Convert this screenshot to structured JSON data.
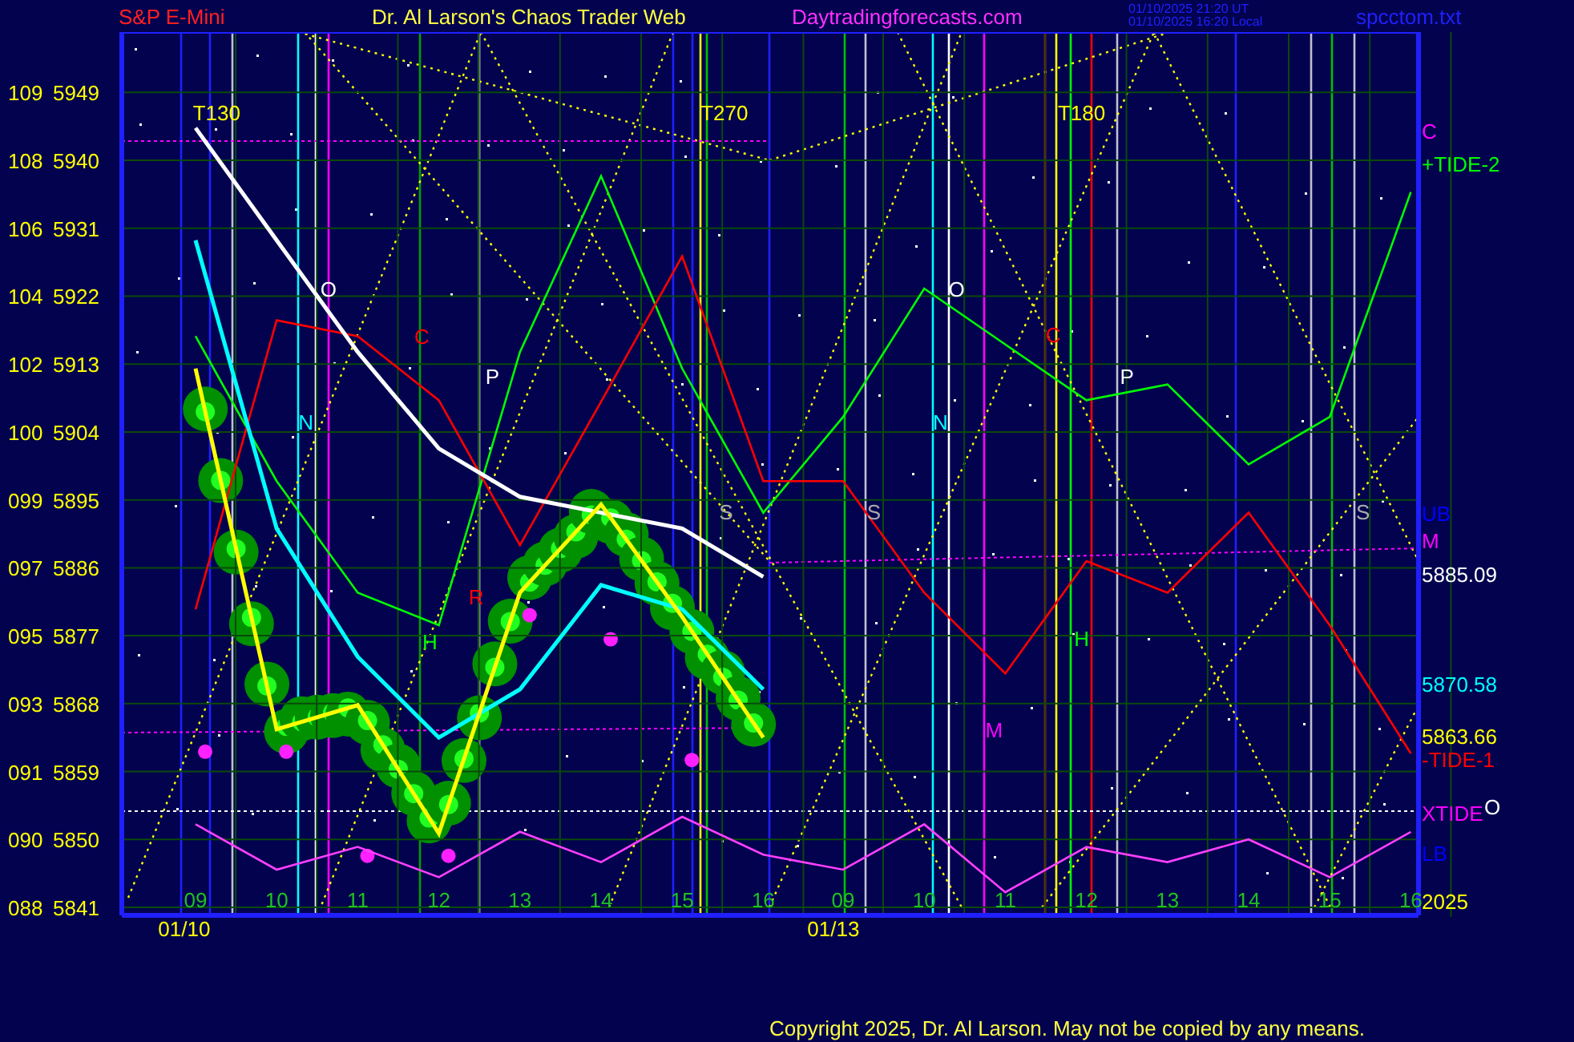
{
  "header": {
    "symbol": "S&P E-Mini",
    "title": "Dr. Al Larson's Chaos Trader Web",
    "site": "Daytradingforecasts.com",
    "time_ut": "01/10/2025 21:20 UT",
    "time_local": "01/10/2025 16:20 Local",
    "file": "spcctom.txt"
  },
  "chart": {
    "index_labels": [
      "109",
      "108",
      "106",
      "104",
      "102",
      "100",
      "099",
      "097",
      "095",
      "093",
      "091",
      "090",
      "088"
    ],
    "date_labels": [
      "01/10",
      "01/13"
    ],
    "right_labels": [
      {
        "text": "C",
        "color": "#ff00ff"
      },
      {
        "text": "+TIDE-2",
        "color": "#00ff00"
      },
      {
        "text": "UB",
        "color": "#0000ff"
      },
      {
        "text": "M",
        "color": "#ff00ff"
      },
      {
        "text": "5885.09",
        "color": "#ffffff"
      },
      {
        "text": "5870.58",
        "color": "#00ffff"
      },
      {
        "text": "5863.66",
        "color": "#ffff00"
      },
      {
        "text": "-TIDE-1",
        "color": "#ff0000"
      },
      {
        "text": "XTIDE",
        "color": "#ff00ff"
      },
      {
        "text": "O",
        "color": "#ffffff"
      },
      {
        "text": "LB",
        "color": "#0000ff"
      },
      {
        "text": "2025",
        "color": "#ffff00"
      }
    ],
    "chart_data": {
      "type": "line",
      "grid": true,
      "categories": [
        "09",
        "10",
        "11",
        "12",
        "13",
        "14",
        "15",
        "16",
        "09",
        "10",
        "11",
        "12",
        "13",
        "14",
        "15",
        "16"
      ],
      "ylim": [
        5841,
        5957
      ],
      "yticks": [
        5949,
        5940,
        5931,
        5922,
        5913,
        5904,
        5895,
        5886,
        5877,
        5868,
        5859,
        5850,
        5841
      ],
      "series": [
        {
          "color": "#00ff00",
          "values": [
            5916.7,
            5897.5,
            5882.7,
            5878.4,
            5914.6,
            5937.9,
            5912.4,
            5893.3,
            5906,
            5923,
            5915.6,
            5908.2,
            5910.3,
            5899.7,
            5906,
            5935.8
          ]
        },
        {
          "color": "#ff0000",
          "values": [
            5880.5,
            5918.8,
            5916.7,
            5908.2,
            5889,
            5908,
            5927.3,
            5897.5,
            5897.5,
            5882.7,
            5872,
            5886.9,
            5882.7,
            5893.3,
            5878.4,
            5861.4
          ]
        },
        {
          "color": "#ffffff",
          "values": [
            5944.3,
            5929.4,
            5914.6,
            5901.8,
            5895.4,
            5893.3,
            5891.2,
            5884.8,
            null,
            null,
            null,
            null,
            null,
            null,
            null,
            null
          ]
        },
        {
          "color": "#00ffff",
          "values": [
            5929.4,
            5891.2,
            5874.2,
            5863.5,
            5869.9,
            5883.7,
            5880.5,
            5869.9,
            null,
            null,
            null,
            null,
            null,
            null,
            null,
            null
          ]
        },
        {
          "color": "#ffff00",
          "values": [
            5912.4,
            5864.6,
            5867.8,
            5850.8,
            5882.7,
            5894.4,
            5879.5,
            5863.5,
            null,
            null,
            null,
            null,
            null,
            null,
            null,
            null
          ]
        },
        {
          "color": "#ff40ff",
          "values": [
            5852,
            5846,
            5849,
            5845,
            5851,
            5847,
            5853,
            5848,
            5846,
            5852,
            5843,
            5849,
            5847,
            5850,
            5845,
            5851
          ]
        }
      ],
      "annotations": [
        "T130",
        "T270",
        "T180",
        "O",
        "C",
        "P",
        "N",
        "R",
        "H",
        "S",
        "S",
        "O",
        "N",
        "C",
        "P",
        "H",
        "M",
        "S"
      ]
    }
  },
  "footer": "Copyright 2025, Dr. Al Larson. May not be copied by any means."
}
